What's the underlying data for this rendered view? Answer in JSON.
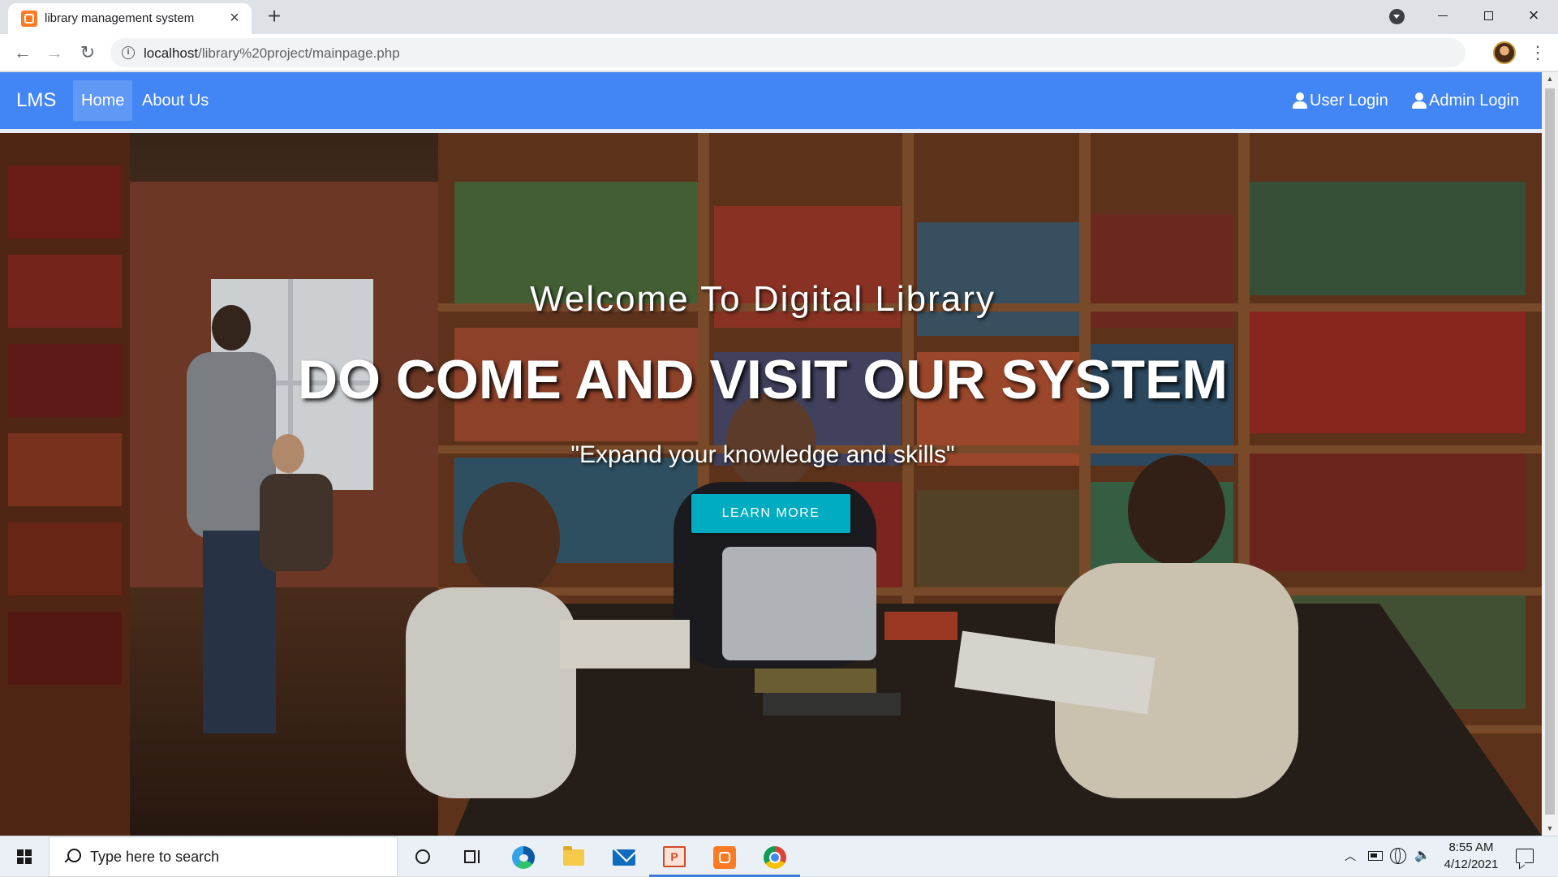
{
  "browser": {
    "tab_title": "library management system",
    "new_tab_label": "+",
    "url_host": "localhost",
    "url_path": "/library%20project/mainpage.php",
    "icons": {
      "favicon": "xampp-icon",
      "back": "back-arrow-icon",
      "forward": "forward-arrow-icon",
      "reload": "reload-icon",
      "info": "site-info-icon",
      "bookmark": "star-icon",
      "profile": "profile-avatar",
      "menu": "kebab-menu-icon"
    }
  },
  "navbar": {
    "brand": "LMS",
    "links": [
      {
        "label": "Home",
        "active": true
      },
      {
        "label": "About Us",
        "active": false
      }
    ],
    "right_links": [
      {
        "label": "User Login",
        "icon": "user-icon"
      },
      {
        "label": "Admin Login",
        "icon": "user-icon"
      }
    ],
    "bg_color": "#4285f4"
  },
  "hero": {
    "subtitle": "Welcome To Digital Library",
    "title": "DO COME AND VISIT OUR SYSTEM",
    "quote": "\"Expand your knowledge and skills\"",
    "button_label": "LEARN MORE",
    "button_color": "#00acc1",
    "background": "photo of students studying at a table in a library with tall wooden bookshelves"
  },
  "taskbar": {
    "search_placeholder": "Type here to search",
    "time": "8:55 AM",
    "date": "4/12/2021",
    "pinned_apps": [
      "cortana",
      "task-view",
      "edge",
      "file-explorer",
      "mail",
      "powerpoint",
      "xampp",
      "chrome"
    ]
  }
}
